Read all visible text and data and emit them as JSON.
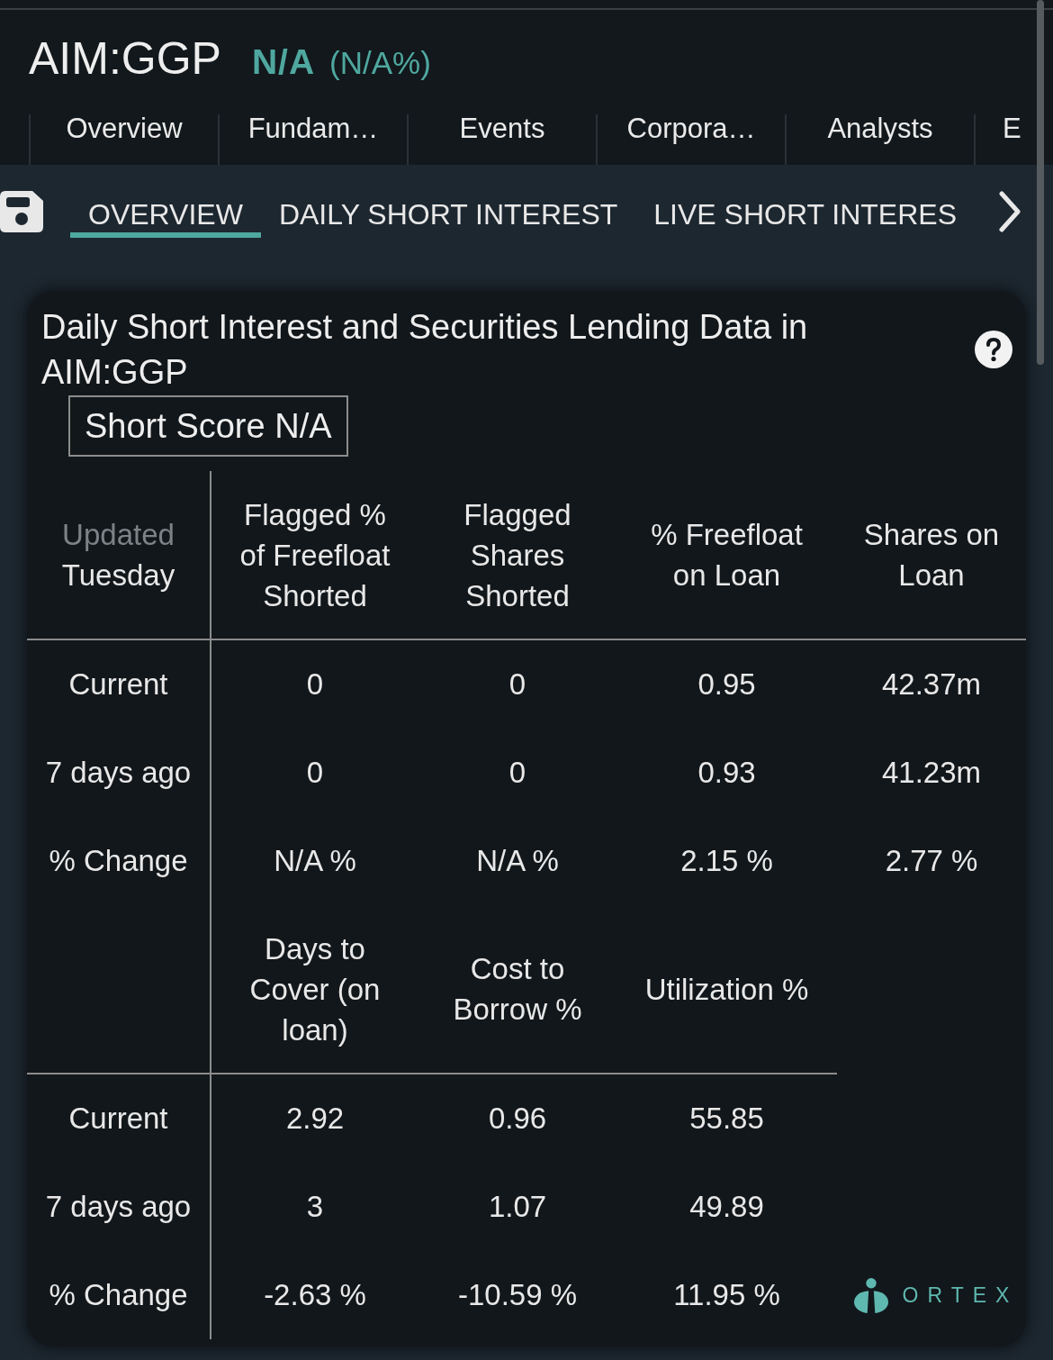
{
  "quote": {
    "ticker": "AIM:GGP",
    "price": "N/A",
    "change": "(N/A%)"
  },
  "tabs": [
    "Overview",
    "Fundam…",
    "Events",
    "Corpora…",
    "Analysts",
    "E"
  ],
  "subtabs": [
    {
      "label": "OVERVIEW",
      "selected": true
    },
    {
      "label": "DAILY SHORT INTEREST",
      "selected": false
    },
    {
      "label": "LIVE SHORT INTERES",
      "selected": false
    }
  ],
  "card": {
    "title": "Daily Short Interest and Securities Lending Data in AIM:GGP",
    "short_score": "Short Score N/A",
    "tables": [
      {
        "updated": {
          "label": "Updated",
          "day": "Tuesday"
        },
        "columns": [
          "Flagged % of Freefloat Shorted",
          "Flagged Shares Shorted",
          "% Freefloat on Loan",
          "Shares on Loan"
        ],
        "rows": [
          {
            "label": "Current",
            "values": [
              "0",
              "0",
              "0.95",
              "42.37m"
            ]
          },
          {
            "label": "7 days ago",
            "values": [
              "0",
              "0",
              "0.93",
              "41.23m"
            ]
          },
          {
            "label": "% Change",
            "values": [
              "N/A %",
              "N/A %",
              "2.15 %",
              "2.77 %"
            ]
          }
        ]
      },
      {
        "columns": [
          "Days to Cover (on loan)",
          "Cost to Borrow %",
          "Utilization %"
        ],
        "rows": [
          {
            "label": "Current",
            "values": [
              "2.92",
              "0.96",
              "55.85"
            ]
          },
          {
            "label": "7 days ago",
            "values": [
              "3",
              "1.07",
              "49.89"
            ]
          },
          {
            "label": "% Change",
            "values": [
              "-2.63 %",
              "-10.59 %",
              "11.95 %"
            ]
          }
        ]
      }
    ],
    "logo": "ORTEX"
  }
}
